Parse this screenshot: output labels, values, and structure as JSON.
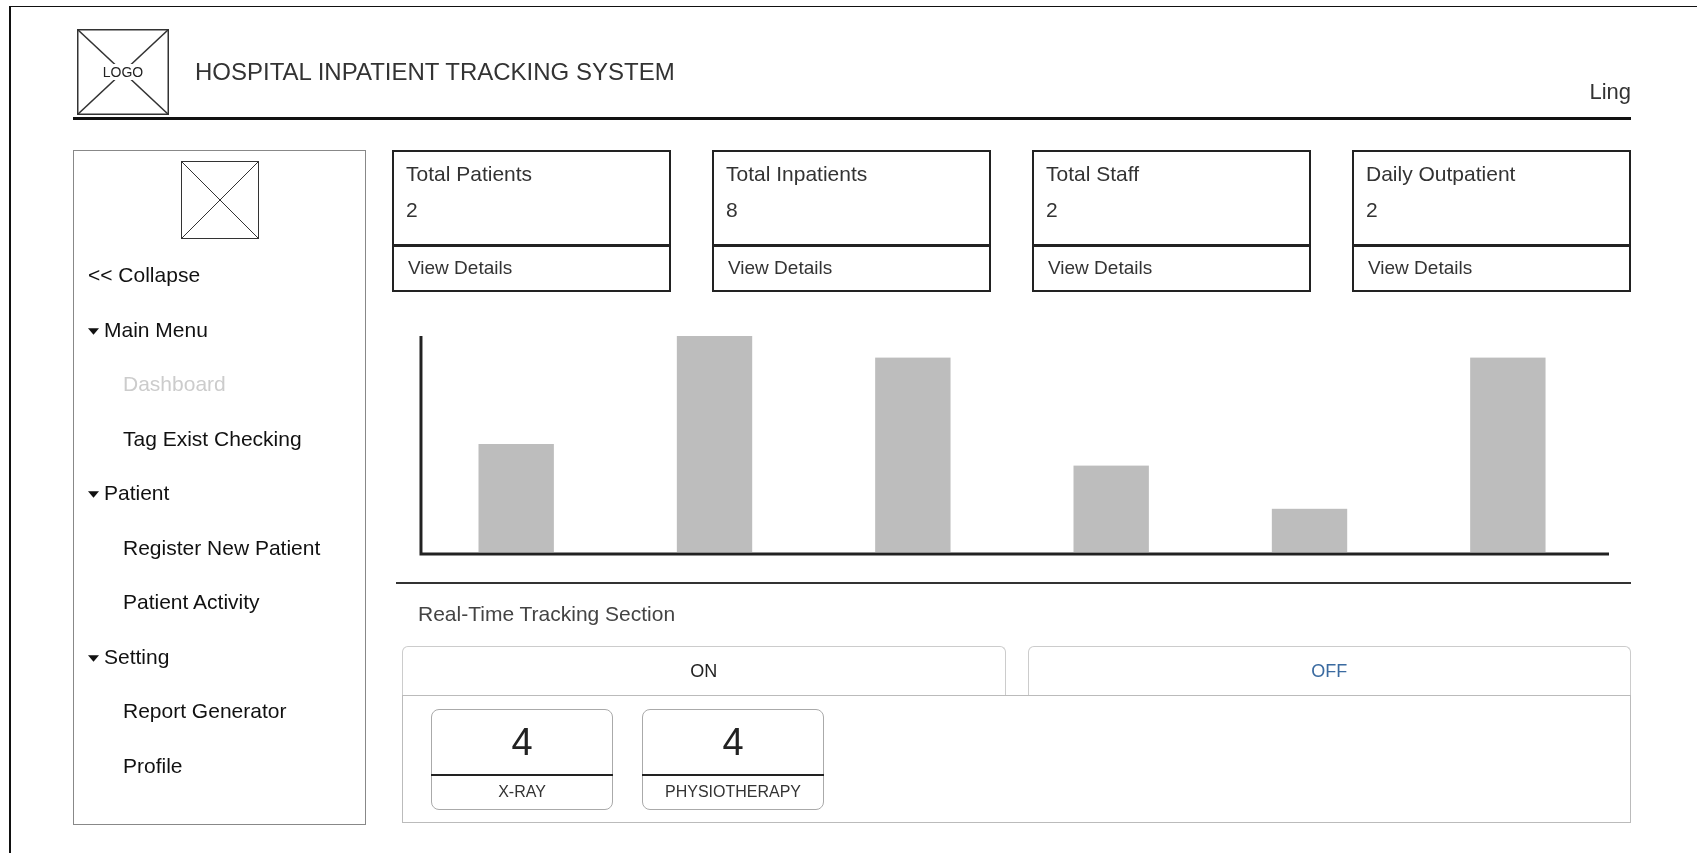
{
  "header": {
    "logo": "LOGO",
    "title": "HOSPITAL INPATIENT TRACKING SYSTEM",
    "user": "Ling"
  },
  "sidebar": {
    "collapse": "<< Collapse",
    "groups": [
      {
        "label": "Main Menu",
        "expanded": true,
        "items": [
          {
            "label": "Dashboard",
            "selected": true
          },
          {
            "label": "Tag Exist Checking",
            "selected": false
          }
        ]
      },
      {
        "label": "Patient",
        "expanded": true,
        "items": [
          {
            "label": "Register New Patient",
            "selected": false
          },
          {
            "label": "Patient Activity",
            "selected": false
          }
        ]
      },
      {
        "label": "Setting",
        "expanded": true,
        "items": [
          {
            "label": "Report Generator",
            "selected": false
          },
          {
            "label": "Profile",
            "selected": false
          }
        ]
      }
    ]
  },
  "stats": [
    {
      "title": "Total Patients",
      "value": "2",
      "link": "View Details"
    },
    {
      "title": "Total Inpatients",
      "value": "8",
      "link": "View Details"
    },
    {
      "title": "Total Staff",
      "value": "2",
      "link": "View Details"
    },
    {
      "title": "Daily Outpatient",
      "value": "2",
      "link": "View Details"
    }
  ],
  "tracking": {
    "title": "Real-Time Tracking Section",
    "tabs": [
      {
        "label": "ON",
        "selected": true
      },
      {
        "label": "OFF",
        "selected": false
      }
    ],
    "counters": [
      {
        "value": "4",
        "label": "X-RAY"
      },
      {
        "value": "4",
        "label": "PHYSIOTHERAPY"
      }
    ]
  }
}
